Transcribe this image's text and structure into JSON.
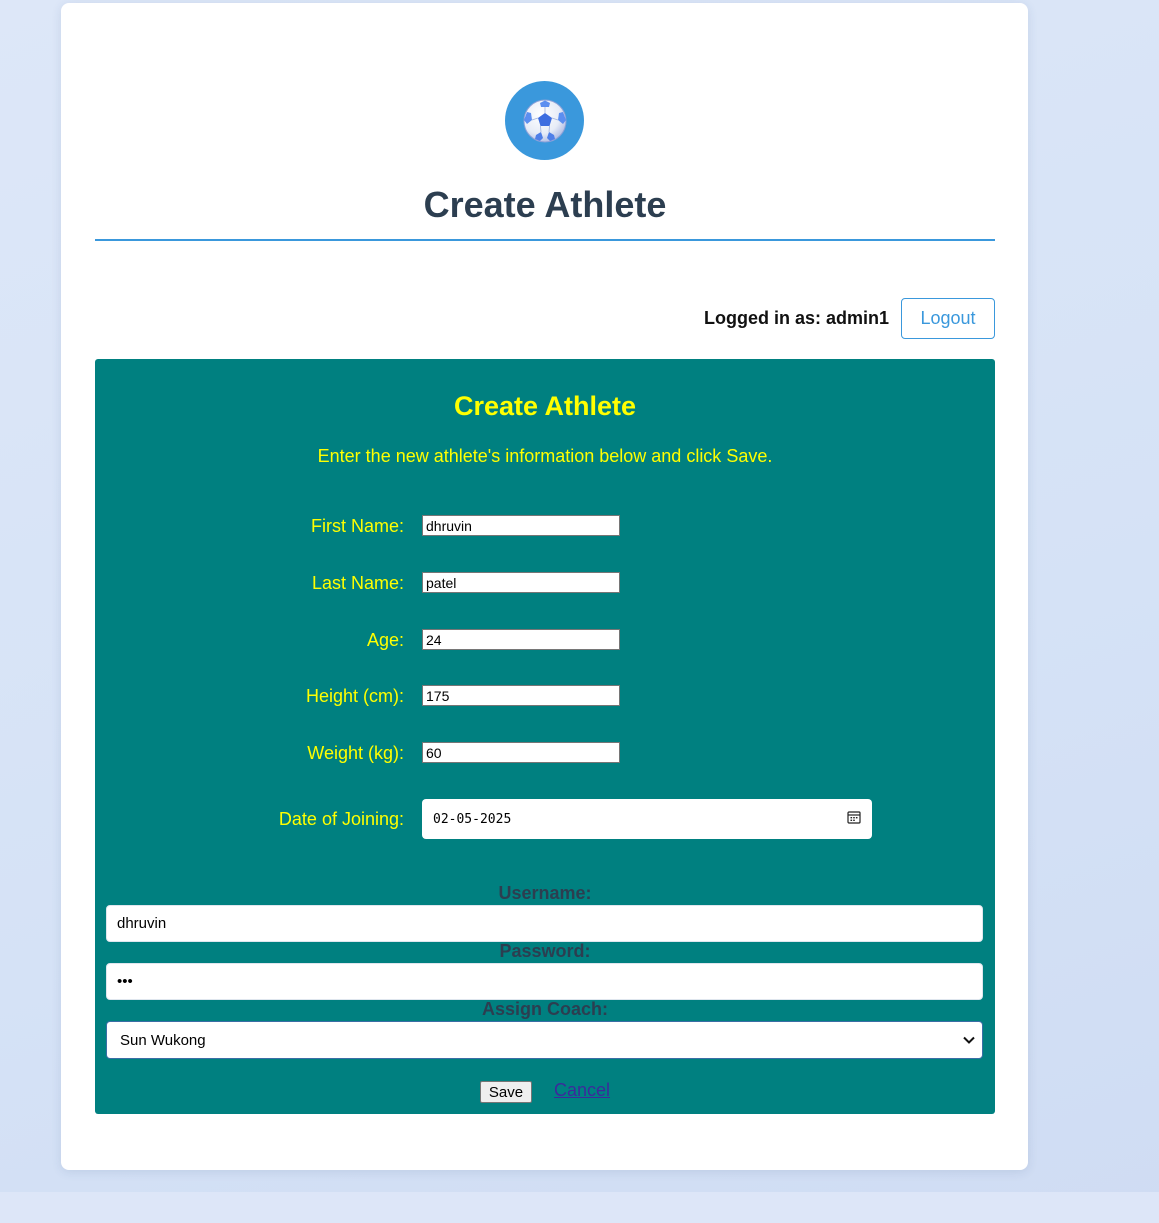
{
  "header": {
    "logo_icon": "soccer-ball-icon",
    "title": "Create Athlete",
    "accent_color": "#3a98dc"
  },
  "user_bar": {
    "logged_in_text": "Logged in as: admin1",
    "logout_label": "Logout"
  },
  "form": {
    "background_color": "#008080",
    "title": "Create Athlete",
    "intro": "Enter the new athlete's information below and click Save.",
    "fields": {
      "first_name": {
        "label": "First Name:",
        "value": "dhruvin"
      },
      "last_name": {
        "label": "Last Name:",
        "value": "patel"
      },
      "age": {
        "label": "Age:",
        "value": "24"
      },
      "height": {
        "label": "Height (cm):",
        "value": "175"
      },
      "weight": {
        "label": "Weight (kg):",
        "value": "60"
      },
      "date_of_joining": {
        "label": "Date of Joining:",
        "value": "02-05-2025",
        "icon": "calendar-icon"
      }
    },
    "username": {
      "label": "Username:",
      "value": "dhruvin"
    },
    "password": {
      "label": "Password:",
      "value": "•••"
    },
    "coach": {
      "label": "Assign Coach:",
      "selected": "Sun Wukong"
    },
    "save_label": "Save",
    "cancel_label": "Cancel"
  }
}
